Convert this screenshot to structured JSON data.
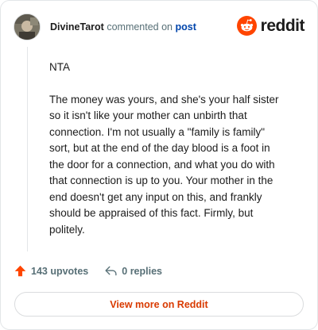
{
  "header": {
    "username": "DivineTarot",
    "commented_text": "commented on",
    "post_link": "post",
    "brand": "reddit"
  },
  "comment": {
    "paragraphs": [
      "NTA",
      "The money was yours, and she's your half sister so it isn't like your mother can unbirth that connection. I'm not usually a \"family is family\" sort, but at the end of the day blood is a foot in the door for a connection, and what you do with that connection is up to you. Your mother in the end doesn't get any input on this, and frankly should be appraised of this fact. Firmly, but politely."
    ]
  },
  "actions": {
    "upvotes": "143 upvotes",
    "replies": "0 replies"
  },
  "view_more": "View more on Reddit",
  "colors": {
    "brand_orange": "#ff4500",
    "link_blue": "#0045ac",
    "muted": "#576f76"
  }
}
